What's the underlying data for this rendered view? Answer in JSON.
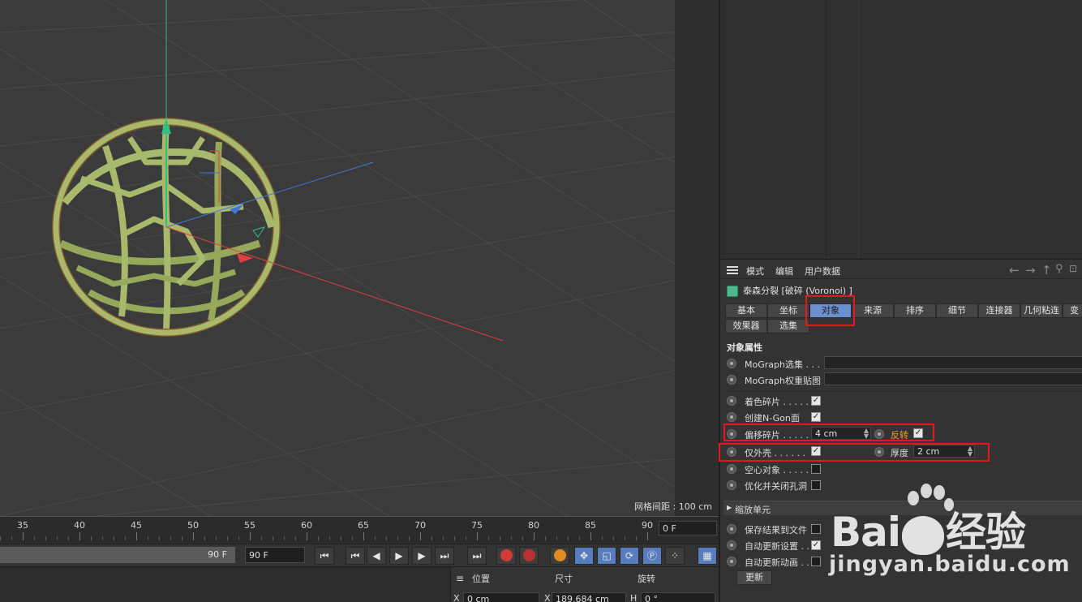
{
  "viewport": {
    "grid_spacing_label": "网格间距 : 100 cm"
  },
  "timeline": {
    "ticks": [
      "35",
      "40",
      "45",
      "50",
      "55",
      "60",
      "65",
      "70",
      "75",
      "80",
      "85",
      "90"
    ],
    "current_frame": "0 F"
  },
  "transport": {
    "range_end_label": "90 F",
    "end_frame_field": "90 F"
  },
  "coords": {
    "headers": {
      "position": "位置",
      "size": "尺寸",
      "rotation": "旋转"
    },
    "x_label": "X",
    "x_position": "0 cm",
    "x_size": "189.684 cm",
    "h_label": "H",
    "h_rotation": "0 °"
  },
  "attributes": {
    "menu": [
      "模式",
      "编辑",
      "用户数据"
    ],
    "object_title": "泰森分裂 [破碎 (Voronoi) ]",
    "tabs_row1": [
      "基本",
      "坐标",
      "对象",
      "来源",
      "排序",
      "细节",
      "连接器",
      "几何粘连",
      "变"
    ],
    "tabs_row2": [
      "效果器",
      "选集"
    ],
    "active_tab": "对象",
    "section_title": "对象属性",
    "links": [
      {
        "label": "MoGraph选集 . . ."
      },
      {
        "label": "MoGraph权重贴图"
      }
    ],
    "props": {
      "color_pieces": {
        "label": "着色碎片 . . . . .",
        "checked": true
      },
      "create_ngon": {
        "label": "创建N-Gon面",
        "checked": true
      },
      "offset_pieces": {
        "label": "偏移碎片 . . . . .",
        "value": "4 cm"
      },
      "invert": {
        "label": "反转",
        "checked": true
      },
      "shell_only": {
        "label": "仅外壳 . . . . . .",
        "checked": true
      },
      "thickness": {
        "label": "厚度",
        "value": "2 cm"
      },
      "hollow_object": {
        "label": "空心对象 . . . . .",
        "checked": false
      },
      "optimize_close_holes": {
        "label": "优化并关闭孔洞",
        "checked": false
      }
    },
    "scale_cells_group": "缩放单元",
    "save_results": {
      "label": "保存结果到文件",
      "checked": false
    },
    "auto_update_settings": {
      "label": "自动更新设置 . .",
      "checked": true
    },
    "auto_update_anim": {
      "label": "自动更新动画 . .",
      "checked": false
    },
    "update_button": "更新"
  },
  "watermark": {
    "brand_prefix": "Bai",
    "brand_suffix": "经验",
    "url": "jingyan.baidu.com"
  },
  "colors": {
    "axis_y": "#2ec27e",
    "axis_x": "#e04040",
    "axis_z": "#3f78d8",
    "mesh": "#8a9a4a",
    "active_tab": "#6c8fd0",
    "highlight_box": "#e6181a",
    "accent_orange": "#f0a030"
  }
}
